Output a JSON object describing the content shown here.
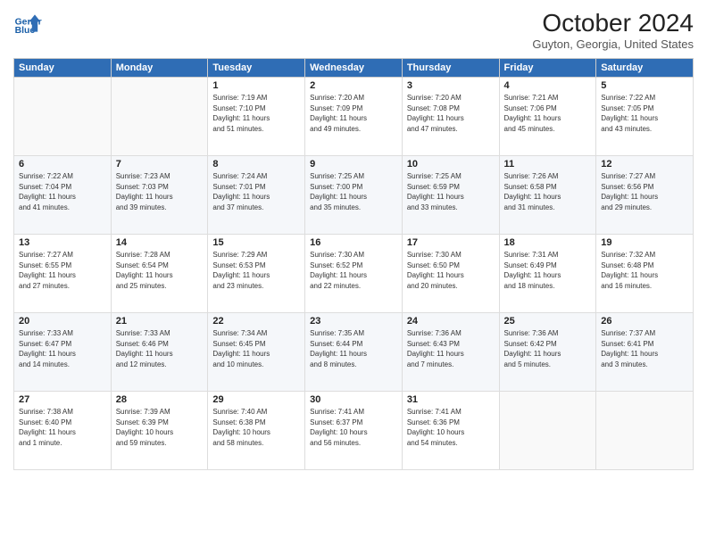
{
  "header": {
    "title": "October 2024",
    "subtitle": "Guyton, Georgia, United States"
  },
  "days": [
    "Sunday",
    "Monday",
    "Tuesday",
    "Wednesday",
    "Thursday",
    "Friday",
    "Saturday"
  ],
  "weeks": [
    [
      {
        "day": "",
        "info": ""
      },
      {
        "day": "",
        "info": ""
      },
      {
        "day": "1",
        "info": "Sunrise: 7:19 AM\nSunset: 7:10 PM\nDaylight: 11 hours\nand 51 minutes."
      },
      {
        "day": "2",
        "info": "Sunrise: 7:20 AM\nSunset: 7:09 PM\nDaylight: 11 hours\nand 49 minutes."
      },
      {
        "day": "3",
        "info": "Sunrise: 7:20 AM\nSunset: 7:08 PM\nDaylight: 11 hours\nand 47 minutes."
      },
      {
        "day": "4",
        "info": "Sunrise: 7:21 AM\nSunset: 7:06 PM\nDaylight: 11 hours\nand 45 minutes."
      },
      {
        "day": "5",
        "info": "Sunrise: 7:22 AM\nSunset: 7:05 PM\nDaylight: 11 hours\nand 43 minutes."
      }
    ],
    [
      {
        "day": "6",
        "info": "Sunrise: 7:22 AM\nSunset: 7:04 PM\nDaylight: 11 hours\nand 41 minutes."
      },
      {
        "day": "7",
        "info": "Sunrise: 7:23 AM\nSunset: 7:03 PM\nDaylight: 11 hours\nand 39 minutes."
      },
      {
        "day": "8",
        "info": "Sunrise: 7:24 AM\nSunset: 7:01 PM\nDaylight: 11 hours\nand 37 minutes."
      },
      {
        "day": "9",
        "info": "Sunrise: 7:25 AM\nSunset: 7:00 PM\nDaylight: 11 hours\nand 35 minutes."
      },
      {
        "day": "10",
        "info": "Sunrise: 7:25 AM\nSunset: 6:59 PM\nDaylight: 11 hours\nand 33 minutes."
      },
      {
        "day": "11",
        "info": "Sunrise: 7:26 AM\nSunset: 6:58 PM\nDaylight: 11 hours\nand 31 minutes."
      },
      {
        "day": "12",
        "info": "Sunrise: 7:27 AM\nSunset: 6:56 PM\nDaylight: 11 hours\nand 29 minutes."
      }
    ],
    [
      {
        "day": "13",
        "info": "Sunrise: 7:27 AM\nSunset: 6:55 PM\nDaylight: 11 hours\nand 27 minutes."
      },
      {
        "day": "14",
        "info": "Sunrise: 7:28 AM\nSunset: 6:54 PM\nDaylight: 11 hours\nand 25 minutes."
      },
      {
        "day": "15",
        "info": "Sunrise: 7:29 AM\nSunset: 6:53 PM\nDaylight: 11 hours\nand 23 minutes."
      },
      {
        "day": "16",
        "info": "Sunrise: 7:30 AM\nSunset: 6:52 PM\nDaylight: 11 hours\nand 22 minutes."
      },
      {
        "day": "17",
        "info": "Sunrise: 7:30 AM\nSunset: 6:50 PM\nDaylight: 11 hours\nand 20 minutes."
      },
      {
        "day": "18",
        "info": "Sunrise: 7:31 AM\nSunset: 6:49 PM\nDaylight: 11 hours\nand 18 minutes."
      },
      {
        "day": "19",
        "info": "Sunrise: 7:32 AM\nSunset: 6:48 PM\nDaylight: 11 hours\nand 16 minutes."
      }
    ],
    [
      {
        "day": "20",
        "info": "Sunrise: 7:33 AM\nSunset: 6:47 PM\nDaylight: 11 hours\nand 14 minutes."
      },
      {
        "day": "21",
        "info": "Sunrise: 7:33 AM\nSunset: 6:46 PM\nDaylight: 11 hours\nand 12 minutes."
      },
      {
        "day": "22",
        "info": "Sunrise: 7:34 AM\nSunset: 6:45 PM\nDaylight: 11 hours\nand 10 minutes."
      },
      {
        "day": "23",
        "info": "Sunrise: 7:35 AM\nSunset: 6:44 PM\nDaylight: 11 hours\nand 8 minutes."
      },
      {
        "day": "24",
        "info": "Sunrise: 7:36 AM\nSunset: 6:43 PM\nDaylight: 11 hours\nand 7 minutes."
      },
      {
        "day": "25",
        "info": "Sunrise: 7:36 AM\nSunset: 6:42 PM\nDaylight: 11 hours\nand 5 minutes."
      },
      {
        "day": "26",
        "info": "Sunrise: 7:37 AM\nSunset: 6:41 PM\nDaylight: 11 hours\nand 3 minutes."
      }
    ],
    [
      {
        "day": "27",
        "info": "Sunrise: 7:38 AM\nSunset: 6:40 PM\nDaylight: 11 hours\nand 1 minute."
      },
      {
        "day": "28",
        "info": "Sunrise: 7:39 AM\nSunset: 6:39 PM\nDaylight: 10 hours\nand 59 minutes."
      },
      {
        "day": "29",
        "info": "Sunrise: 7:40 AM\nSunset: 6:38 PM\nDaylight: 10 hours\nand 58 minutes."
      },
      {
        "day": "30",
        "info": "Sunrise: 7:41 AM\nSunset: 6:37 PM\nDaylight: 10 hours\nand 56 minutes."
      },
      {
        "day": "31",
        "info": "Sunrise: 7:41 AM\nSunset: 6:36 PM\nDaylight: 10 hours\nand 54 minutes."
      },
      {
        "day": "",
        "info": ""
      },
      {
        "day": "",
        "info": ""
      }
    ]
  ]
}
